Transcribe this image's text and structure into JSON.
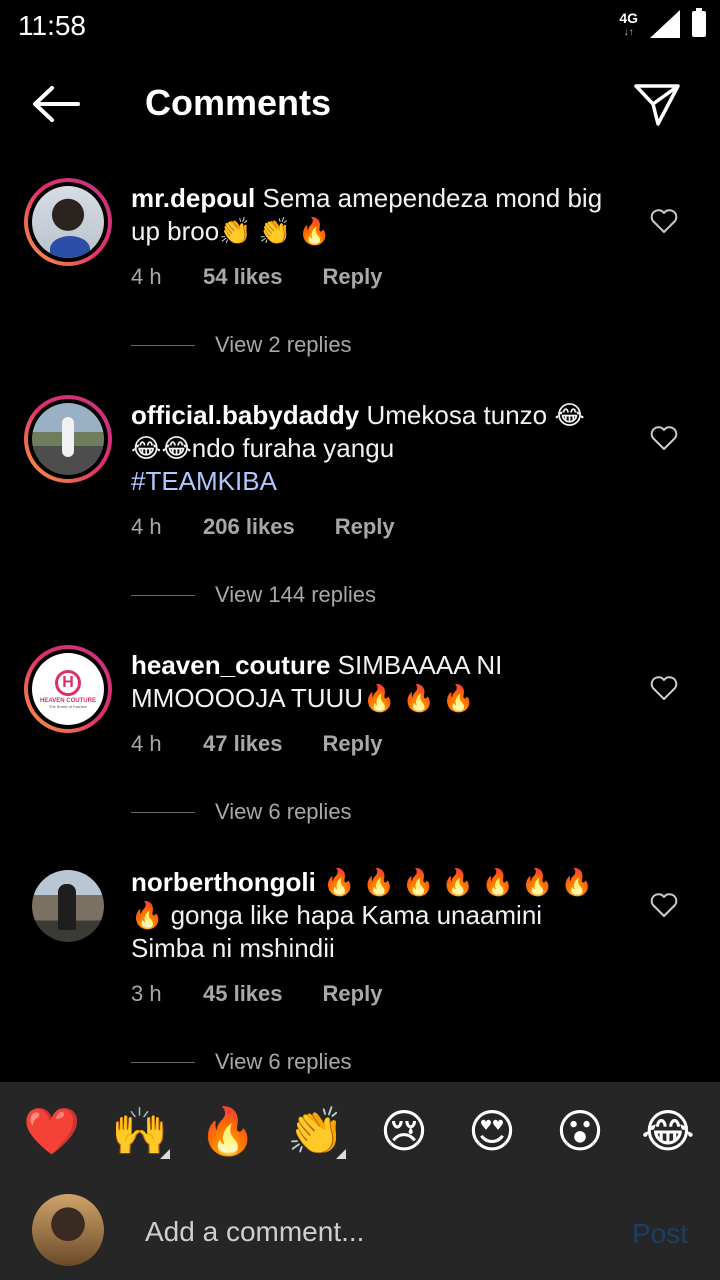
{
  "status": {
    "time": "11:58",
    "network": "4G"
  },
  "header": {
    "title": "Comments"
  },
  "comments": [
    {
      "username": "mr.depoul",
      "text": "Sema amependeza mond big up broo👏 👏 🔥",
      "time": "4 h",
      "likes": "54 likes",
      "reply": "Reply",
      "view_replies": "View 2 replies"
    },
    {
      "username": "official.babydaddy",
      "text": "Umekosa tunzo 😂 😂😂ndo furaha yangu",
      "hashtag": "#TEAMKIBA",
      "time": "4 h",
      "likes": "206 likes",
      "reply": "Reply",
      "view_replies": "View 144 replies"
    },
    {
      "username": "heaven_couture",
      "text": "SIMBAAAA NI MMOOOOJA TUUU🔥 🔥 🔥",
      "avatar_text": "HEAVEN COUTURE",
      "avatar_sub": "The Bomb of Fashion",
      "time": "4 h",
      "likes": "47 likes",
      "reply": "Reply",
      "view_replies": "View 6 replies"
    },
    {
      "username": "norberthongoli",
      "text": "🔥 🔥 🔥 🔥 🔥 🔥 🔥 🔥 gonga like hapa Kama unaamini Simba ni mshindii",
      "time": "3 h",
      "likes": "45 likes",
      "reply": "Reply",
      "view_replies": "View 6 replies"
    }
  ],
  "emoji_bar": [
    "❤️",
    "🙌",
    "🔥",
    "👏",
    "😢",
    "😍",
    "😮",
    "😂"
  ],
  "composer": {
    "placeholder": "Add a comment...",
    "post_label": "Post"
  },
  "colors": {
    "background": "#000000",
    "panel": "#262626",
    "muted": "#a8a8a8",
    "post_disabled": "#1c3e63"
  }
}
